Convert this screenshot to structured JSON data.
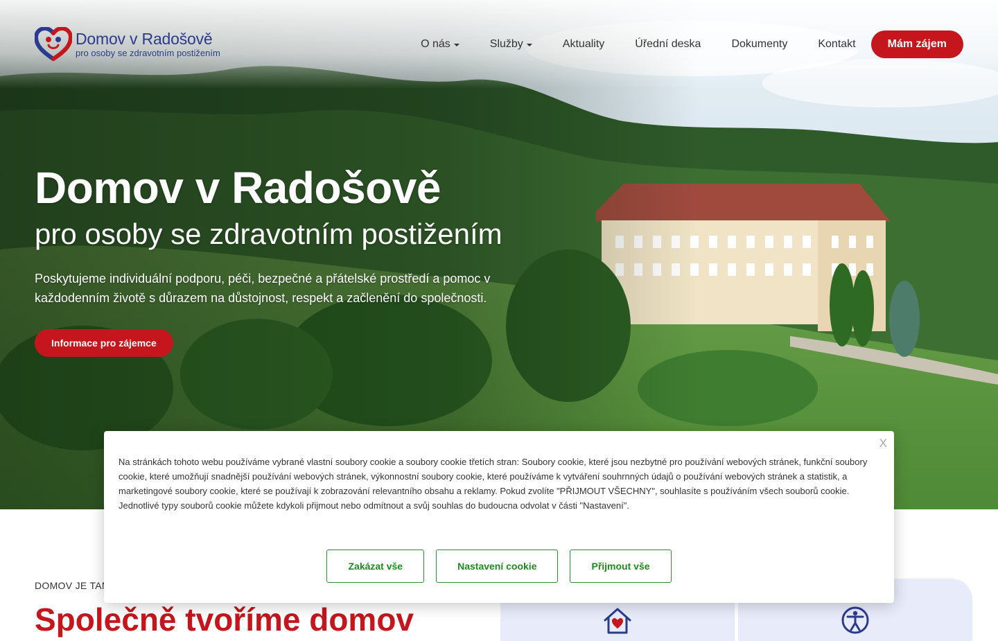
{
  "colors": {
    "brand_red": "#c4161c",
    "brand_blue": "#2a3a8f",
    "cookie_green": "#1f8a1f",
    "card_bg": "#e8ecfa"
  },
  "header": {
    "logo": {
      "title": "Domov v Radošově",
      "subtitle": "pro osoby se zdravotním postižením",
      "icon": "heart-logo-icon"
    },
    "nav": [
      {
        "label": "O nás",
        "dropdown": true
      },
      {
        "label": "Služby",
        "dropdown": true
      },
      {
        "label": "Aktuality",
        "dropdown": false
      },
      {
        "label": "Úřední deska",
        "dropdown": false
      },
      {
        "label": "Dokumenty",
        "dropdown": false
      },
      {
        "label": "Kontakt",
        "dropdown": false
      }
    ],
    "cta_label": "Mám zájem"
  },
  "hero": {
    "title": "Domov v Radošově",
    "subtitle": "pro osoby se zdravotním postižením",
    "text": "Poskytujeme individuální podporu, péči, bezpečné a přátelské prostředí a pomoc v každodenním životě s důrazem na důstojnost, respekt a začlenění do společnosti.",
    "button_label": "Informace pro zájemce"
  },
  "section": {
    "eyebrow": "DOMOV JE TAM",
    "heading": "Společně tvoříme domov",
    "cards": [
      {
        "icon": "home-heart-icon"
      },
      {
        "icon": "accessibility-icon"
      }
    ]
  },
  "cookie": {
    "close_label": "X",
    "text": "Na stránkách tohoto webu používáme vybrané vlastní soubory cookie a soubory cookie třetích stran: Soubory cookie, které jsou nezbytné pro používání webových stránek, funkční soubory cookie, které umožňují snadnější používání webových stránek, výkonnostní soubory cookie, které používáme k vytváření souhrnných údajů o používání webových stránek a statistik, a marketingové soubory cookie, které se používají k zobrazování relevantního obsahu a reklamy. Pokud zvolíte \"PŘIJMOUT VŠECHNY\", souhlasíte s používáním všech souborů cookie. Jednotlivé typy souborů cookie můžete kdykoli přijmout nebo odmítnout a svůj souhlas do budoucna odvolat v části \"Nastavení\".",
    "buttons": {
      "reject": "Zakázat vše",
      "settings": "Nastavení cookie",
      "accept": "Přijmout vše"
    }
  }
}
